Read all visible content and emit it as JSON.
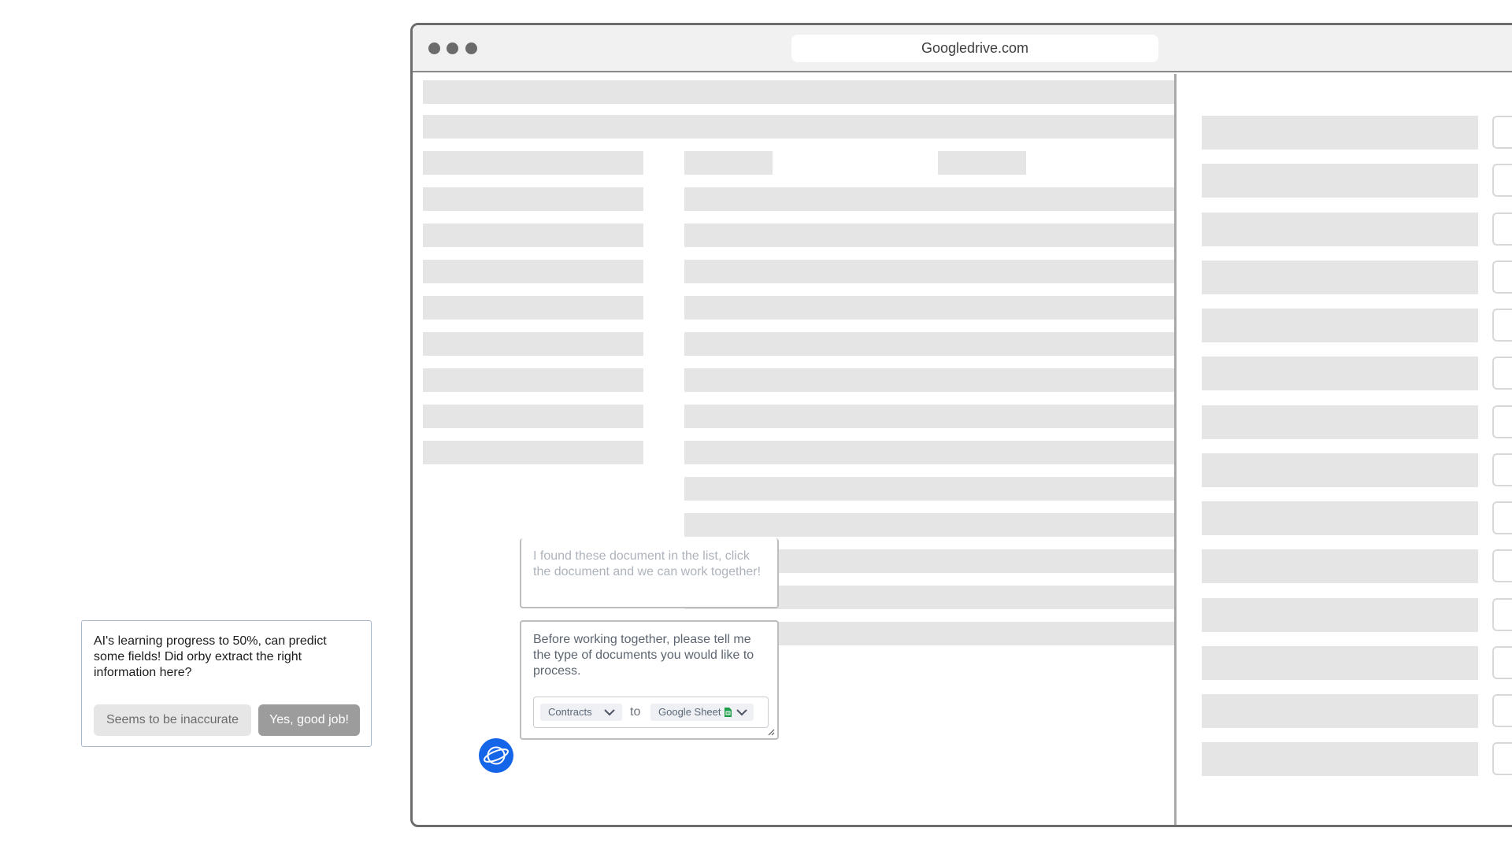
{
  "browser": {
    "url": "Googledrive.com"
  },
  "chat": {
    "message_found": "I found these document in the list, click the document and we can work together!",
    "message_ask": "Before working together, please tell me the type of documents you would like to process.",
    "doc_type_selected": "Contracts",
    "connector_word": "to",
    "destination_selected": "Google Sheet",
    "icons": {
      "assistant": "orby-planet-icon",
      "sheet": "google-sheet-icon",
      "dropdown": "chevron-down-icon",
      "resize": "resize-handle-icon"
    }
  },
  "feedback": {
    "prompt": "AI's learning progress to 50%, can predict some fields! Did orby extract the right information here?",
    "negative_label": "Seems to be inaccurate",
    "positive_label": "Yes, good job!"
  },
  "colors": {
    "accent": "#1565e8",
    "placeholder_bar": "#e5e5e5",
    "sheet_green": "#1e9e4a"
  }
}
